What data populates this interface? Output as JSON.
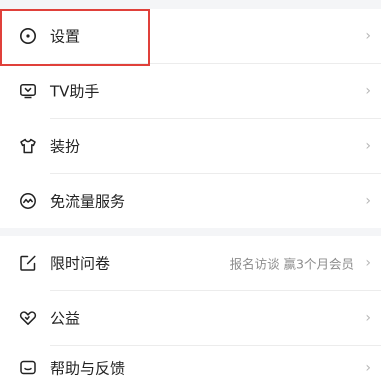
{
  "menu": {
    "group1": [
      {
        "label": "设置",
        "icon": "clock-circle-icon"
      },
      {
        "label": "TV助手",
        "icon": "tv-icon"
      },
      {
        "label": "装扮",
        "icon": "tshirt-icon"
      },
      {
        "label": "免流量服务",
        "icon": "wave-circle-icon"
      }
    ],
    "group2": [
      {
        "label": "限时问卷",
        "icon": "edit-icon",
        "extra": "报名访谈 赢3个月会员"
      },
      {
        "label": "公益",
        "icon": "heart-icon"
      },
      {
        "label": "帮助与反馈",
        "icon": "message-square-icon"
      }
    ],
    "chevron": "›"
  },
  "colors": {
    "page_bg": "#f4f5f7",
    "card_bg": "#ffffff",
    "text": "#222222",
    "secondary_text": "#8c8c8c",
    "chevron": "#b6b6b6",
    "highlight_border": "#e0403a"
  }
}
